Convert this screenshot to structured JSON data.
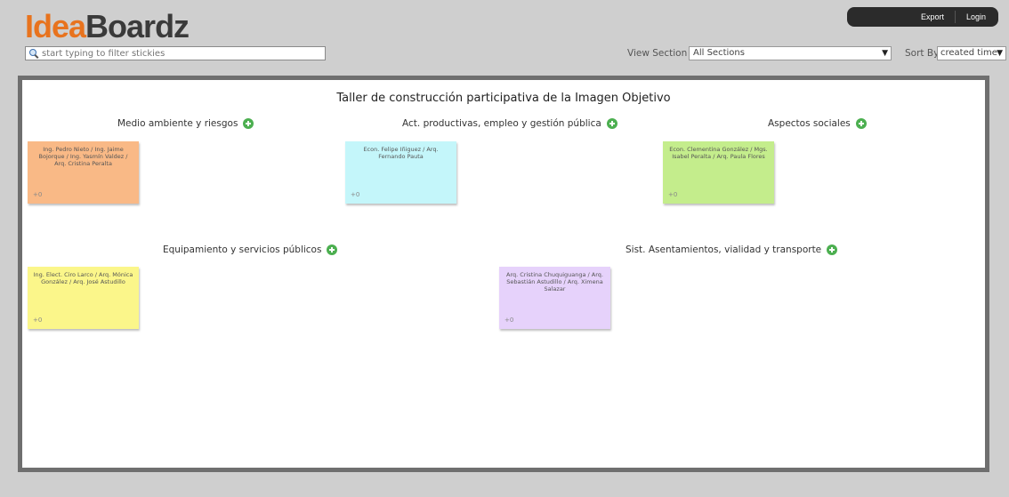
{
  "app": {
    "logo_part1": "Idea",
    "logo_part2": "Boardz"
  },
  "topbar": {
    "export_label": "Export",
    "login_label": "Login"
  },
  "filter": {
    "placeholder": "start typing to filter stickies"
  },
  "view_section": {
    "label": "View Section",
    "selected": "All Sections"
  },
  "sort": {
    "label": "Sort By",
    "selected": "created time"
  },
  "board": {
    "title": "Taller de construcción participativa de la Imagen Objetivo",
    "sections": [
      {
        "name": "Medio ambiente y riesgos",
        "stickies": [
          {
            "text": "Ing. Pedro Nieto / Ing. Jaime Bojorque / Ing. Yasmín Valdez / Arq. Cristina Peralta",
            "votes": "+0",
            "color": "#f9b986"
          }
        ]
      },
      {
        "name": "Act. productivas, empleo y gestión pública",
        "stickies": [
          {
            "text": "Econ. Felipe Iñiguez / Arq. Fernando Pauta",
            "votes": "+0",
            "color": "#c4f6fa"
          }
        ]
      },
      {
        "name": "Aspectos sociales",
        "stickies": [
          {
            "text": "Econ. Clementina González / Mgs. Isabel Peralta / Arq. Paula Flores",
            "votes": "+0",
            "color": "#c4ed8c"
          }
        ]
      },
      {
        "name": "Equipamiento y servicios públicos",
        "stickies": [
          {
            "text": "Ing. Elect. Ciro Larco / Arq. Mónica González / Arq. José Astudillo",
            "votes": "+0",
            "color": "#fbf68a"
          }
        ]
      },
      {
        "name": "Sist. Asentamientos, vialidad y transporte",
        "stickies": [
          {
            "text": "Arq. Cristina Chuquiguanga / Arq. Sebastián Astudillo / Arq. Ximena Salazar",
            "votes": "+0",
            "color": "#e6d2fb"
          }
        ]
      }
    ]
  }
}
